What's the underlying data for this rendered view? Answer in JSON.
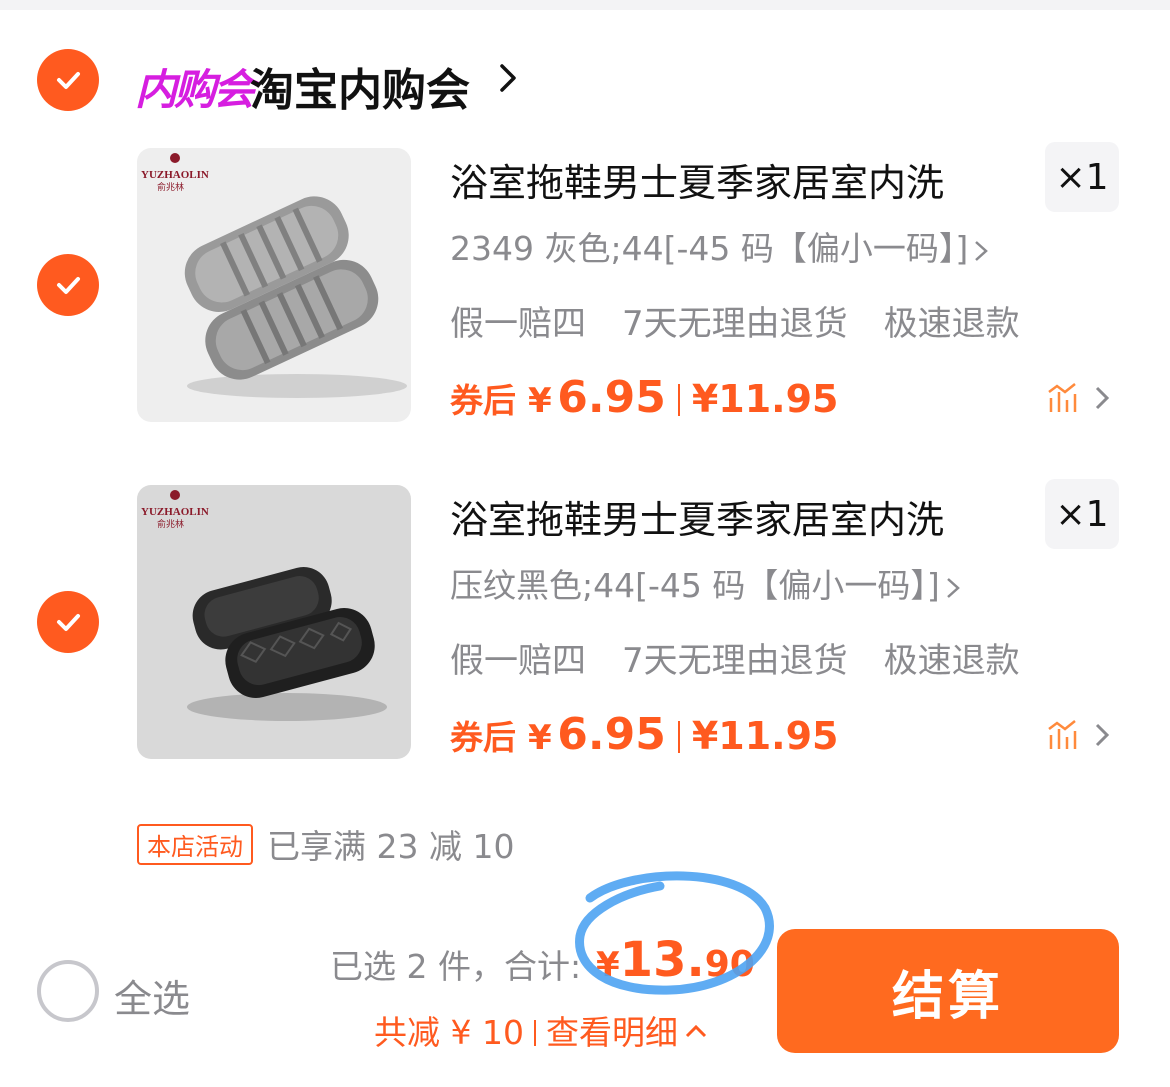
{
  "store": {
    "badge": "内购会",
    "name": "淘宝内购会"
  },
  "items": [
    {
      "title": "浴室拖鞋男士夏季家居室内洗",
      "qty": "×1",
      "sku": "2349 灰色;44[-45 码【偏小一码】]",
      "tags": [
        "假一赔四",
        "7天无理由退货",
        "极速退款"
      ],
      "coupon_label": "券后",
      "coupon_price_yen": "¥",
      "coupon_price": "6.95",
      "original_price": "¥11.95",
      "color": "gray",
      "brand": "YUZHAOLIN",
      "brand_cn": "俞兆林"
    },
    {
      "title": "浴室拖鞋男士夏季家居室内洗",
      "qty": "×1",
      "sku": "压纹黑色;44[-45 码【偏小一码】]",
      "tags": [
        "假一赔四",
        "7天无理由退货",
        "极速退款"
      ],
      "coupon_label": "券后",
      "coupon_price_yen": "¥",
      "coupon_price": "6.95",
      "original_price": "¥11.95",
      "color": "black",
      "brand": "YUZHAOLIN",
      "brand_cn": "俞兆林"
    }
  ],
  "activity": {
    "badge": "本店活动",
    "text": "已享满 23 减 10"
  },
  "footer": {
    "select_all": "全选",
    "summary": "已选 2 件，合计:",
    "total_yen": "¥",
    "total_int": "13.",
    "total_dec": "90",
    "discount_label": "共减 ¥ 10",
    "details_label": "查看明细",
    "checkout": "结算"
  },
  "colors": {
    "accent": "#ff5a1f",
    "badge_pink": "#d61ee0",
    "annotation_blue": "#4ea3f2"
  }
}
